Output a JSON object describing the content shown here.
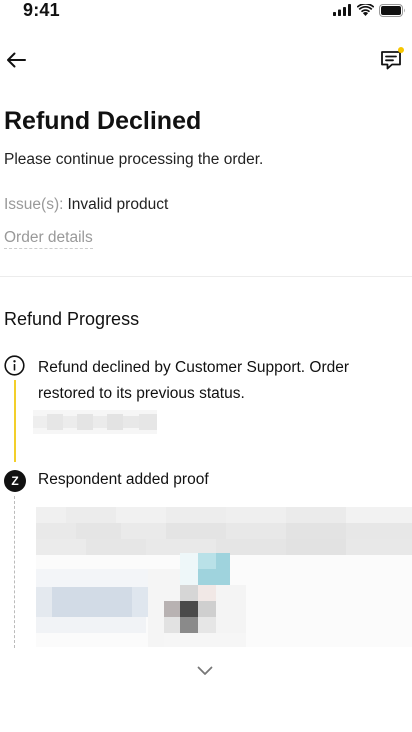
{
  "status_bar": {
    "time": "9:41"
  },
  "nav": {
    "back_icon": "arrow-left-icon",
    "chat_icon": "chat-icon",
    "badge_color": "#f6c600"
  },
  "header": {
    "title": "Refund Declined",
    "subtitle": "Please continue processing the order.",
    "issue_label": "Issue(s):",
    "issue_value": "Invalid product",
    "order_details_link": "Order details"
  },
  "progress": {
    "title": "Refund Progress",
    "events": [
      {
        "icon": "info-icon",
        "text": "Refund declined by Customer Support. Order restored to its previous status.",
        "line_color": "#f3cf2a"
      },
      {
        "avatar_letter": "Z",
        "text": "Respondent added proof"
      }
    ]
  },
  "footer": {
    "expand_icon": "chevron-down-icon"
  }
}
